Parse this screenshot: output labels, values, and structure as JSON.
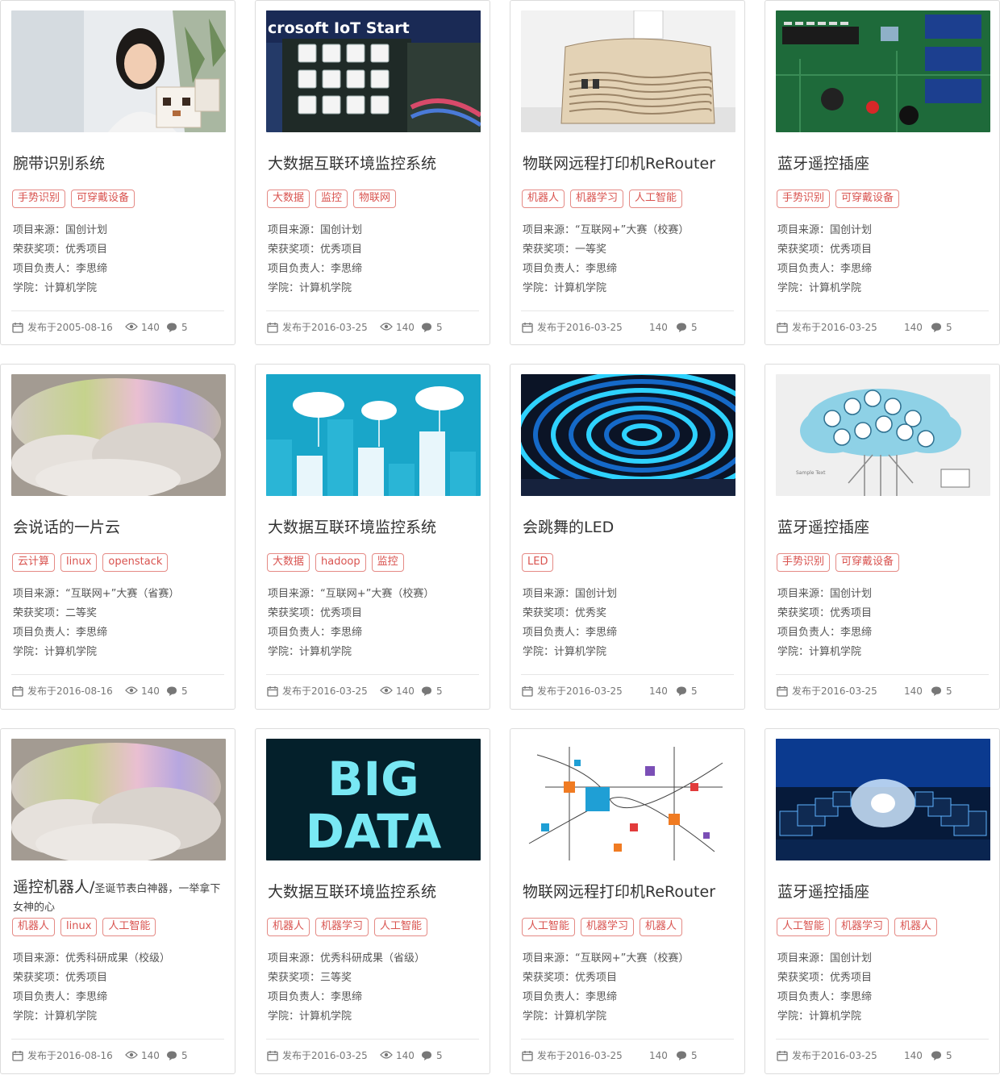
{
  "labels": {
    "source": "项目来源：",
    "award": "荣获奖项：",
    "owner": "项目负责人：",
    "college": "学院："
  },
  "colors": {
    "tag_border": "#e58a85",
    "tag_text": "#d9534f",
    "card_border": "#dcdcdc"
  },
  "cards": [
    {
      "image": "woman-holding-robot-photo",
      "title": "腕带识别系统",
      "tags": [
        "手势识别",
        "可穿戴设备"
      ],
      "source": "国创计划",
      "award": "优秀项目",
      "owner": "李思缔",
      "college": "计算机学院",
      "date": "发布于2005-08-16",
      "views": "140",
      "comments": "5"
    },
    {
      "image": "microsoft-iot-starter-board-photo",
      "image_text": "crosoft IoT Start",
      "title": "大数据互联环境监控系统",
      "tags": [
        "大数据",
        "监控",
        "物联网"
      ],
      "source": "国创计划",
      "award": "优秀项目",
      "owner": "李思缔",
      "college": "计算机学院",
      "date": "发布于2016-03-25",
      "views": "140",
      "comments": "5"
    },
    {
      "image": "wooden-printer-photo",
      "title": "物联网远程打印机ReRouter",
      "tags": [
        "机器人",
        "机器学习",
        "人工智能"
      ],
      "source": "“互联网+”大赛（校赛）",
      "award": "一等奖",
      "owner": "李思缔",
      "college": "计算机学院",
      "date": "发布于2016-03-25",
      "views": "140",
      "comments": "5"
    },
    {
      "image": "circuit-board-photo",
      "title": "蓝牙遥控插座",
      "tags": [
        "手势识别",
        "可穿戴设备"
      ],
      "source": "国创计划",
      "award": "优秀项目",
      "owner": "李思缔",
      "college": "计算机学院",
      "date": "发布于2016-03-25",
      "views": "140",
      "comments": "5"
    },
    {
      "image": "glowing-cloud-lamp-photo",
      "title": "会说话的一片云",
      "tags": [
        "云计算",
        "linux",
        "openstack"
      ],
      "source": "“互联网+”大赛（省赛）",
      "award": "二等奖",
      "owner": "李思缔",
      "college": "计算机学院",
      "date": "发布于2016-08-16",
      "views": "140",
      "comments": "5"
    },
    {
      "image": "cloud-city-illustration",
      "title": "大数据互联环境监控系统",
      "tags": [
        "大数据",
        "hadoop",
        "监控"
      ],
      "source": "“互联网+”大赛（校赛）",
      "award": "优秀项目",
      "owner": "李思缔",
      "college": "计算机学院",
      "date": "发布于2016-03-25",
      "views": "140",
      "comments": "5"
    },
    {
      "image": "led-light-rings-photo",
      "title": "会跳舞的LED",
      "tags": [
        "LED"
      ],
      "source": "国创计划",
      "award": "优秀奖",
      "owner": "李思缔",
      "college": "计算机学院",
      "date": "发布于2016-03-25",
      "views": "140",
      "comments": "5"
    },
    {
      "image": "cloud-icons-infographic",
      "image_text": "Sample Text",
      "title": "蓝牙遥控插座",
      "tags": [
        "手势识别",
        "可穿戴设备"
      ],
      "source": "国创计划",
      "award": "优秀项目",
      "owner": "李思缔",
      "college": "计算机学院",
      "date": "发布于2016-03-25",
      "views": "140",
      "comments": "5"
    },
    {
      "image": "glowing-cloud-lamp-photo",
      "title": "遥控机器人/",
      "title_sub": "圣诞节表白神器，一举拿下女神的心",
      "tags": [
        "机器人",
        "linux",
        "人工智能"
      ],
      "source": "优秀科研成果（校级）",
      "award": "优秀项目",
      "owner": "李思缔",
      "college": "计算机学院",
      "date": "发布于2016-08-16",
      "views": "140",
      "comments": "5"
    },
    {
      "image": "big-data-banner",
      "image_text": [
        "BIG",
        "DATA"
      ],
      "title": "大数据互联环境监控系统",
      "tags": [
        "机器人",
        "机器学习",
        "人工智能"
      ],
      "source": "优秀科研成果（省级）",
      "award": "三等奖",
      "owner": "李思缔",
      "college": "计算机学院",
      "date": "发布于2016-03-25",
      "views": "140",
      "comments": "5"
    },
    {
      "image": "network-nodes-illustration",
      "title": "物联网远程打印机ReRouter",
      "tags": [
        "人工智能",
        "机器学习",
        "机器人"
      ],
      "source": "“互联网+”大赛（校赛）",
      "award": "优秀项目",
      "owner": "李思缔",
      "college": "计算机学院",
      "date": "发布于2016-03-25",
      "views": "140",
      "comments": "5"
    },
    {
      "image": "server-monitors-tunnel",
      "title": "蓝牙遥控插座",
      "tags": [
        "人工智能",
        "机器学习",
        "机器人"
      ],
      "source": "国创计划",
      "award": "优秀项目",
      "owner": "李思缔",
      "college": "计算机学院",
      "date": "发布于2016-03-25",
      "views": "140",
      "comments": "5"
    }
  ]
}
